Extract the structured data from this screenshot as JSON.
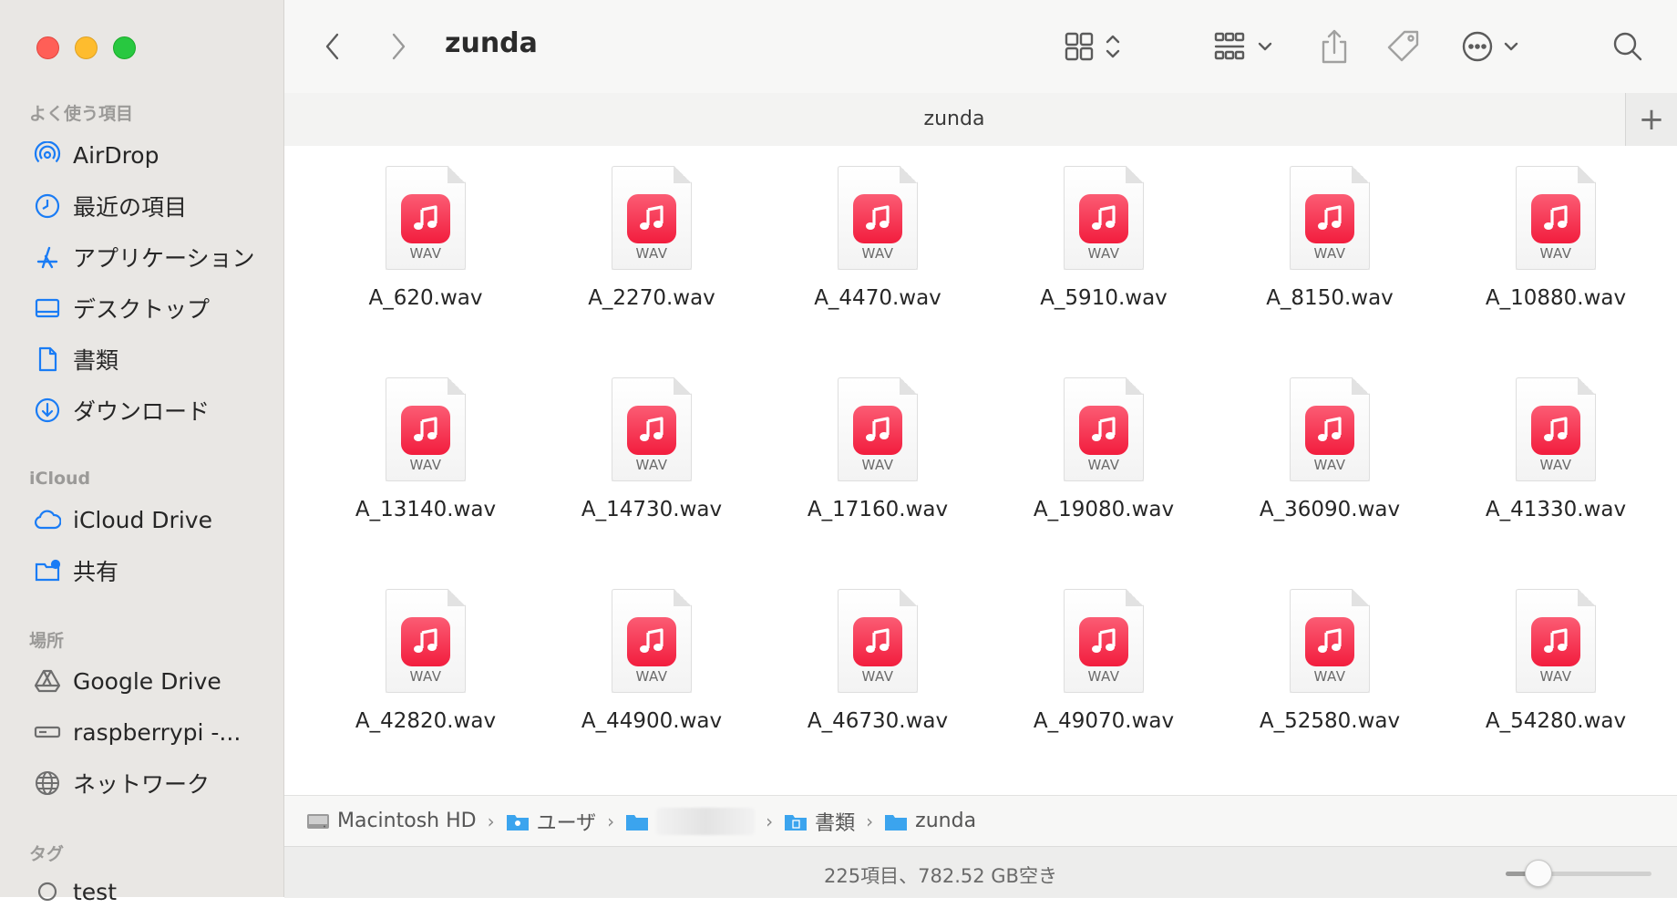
{
  "window": {
    "title": "zunda",
    "tab_label": "zunda",
    "tab_add_label": "+"
  },
  "sidebar": {
    "sections": [
      {
        "heading": "よく使う項目",
        "items": [
          {
            "label": "AirDrop",
            "icon": "airdrop-icon"
          },
          {
            "label": "最近の項目",
            "icon": "clock-icon"
          },
          {
            "label": "アプリケーション",
            "icon": "applications-icon"
          },
          {
            "label": "デスクトップ",
            "icon": "desktop-icon"
          },
          {
            "label": "書類",
            "icon": "document-icon"
          },
          {
            "label": "ダウンロード",
            "icon": "download-icon"
          }
        ]
      },
      {
        "heading": "iCloud",
        "items": [
          {
            "label": "iCloud Drive",
            "icon": "cloud-icon"
          },
          {
            "label": "共有",
            "icon": "shared-folder-icon"
          }
        ]
      },
      {
        "heading": "場所",
        "items": [
          {
            "label": "Google Drive",
            "icon": "google-drive-icon"
          },
          {
            "label": "raspberrypi -...",
            "icon": "server-icon"
          },
          {
            "label": "ネットワーク",
            "icon": "network-icon"
          }
        ]
      },
      {
        "heading": "タグ",
        "items": [
          {
            "label": "test",
            "icon": "tag-circle-icon"
          }
        ]
      }
    ]
  },
  "files": {
    "extension_label": "WAV",
    "items": [
      "A_620.wav",
      "A_2270.wav",
      "A_4470.wav",
      "A_5910.wav",
      "A_8150.wav",
      "A_10880.wav",
      "A_13140.wav",
      "A_14730.wav",
      "A_17160.wav",
      "A_19080.wav",
      "A_36090.wav",
      "A_41330.wav",
      "A_42820.wav",
      "A_44900.wav",
      "A_46730.wav",
      "A_49070.wav",
      "A_52580.wav",
      "A_54280.wav"
    ]
  },
  "pathbar": {
    "crumbs": [
      "Macintosh HD",
      "ユーザ",
      "",
      "書類",
      "zunda"
    ]
  },
  "status": {
    "text": "225項目、782.52 GB空き",
    "icon_size_fraction": 0.22
  },
  "colors": {
    "accent": "#1a7cf5",
    "music_icon": "#f21d3e"
  }
}
